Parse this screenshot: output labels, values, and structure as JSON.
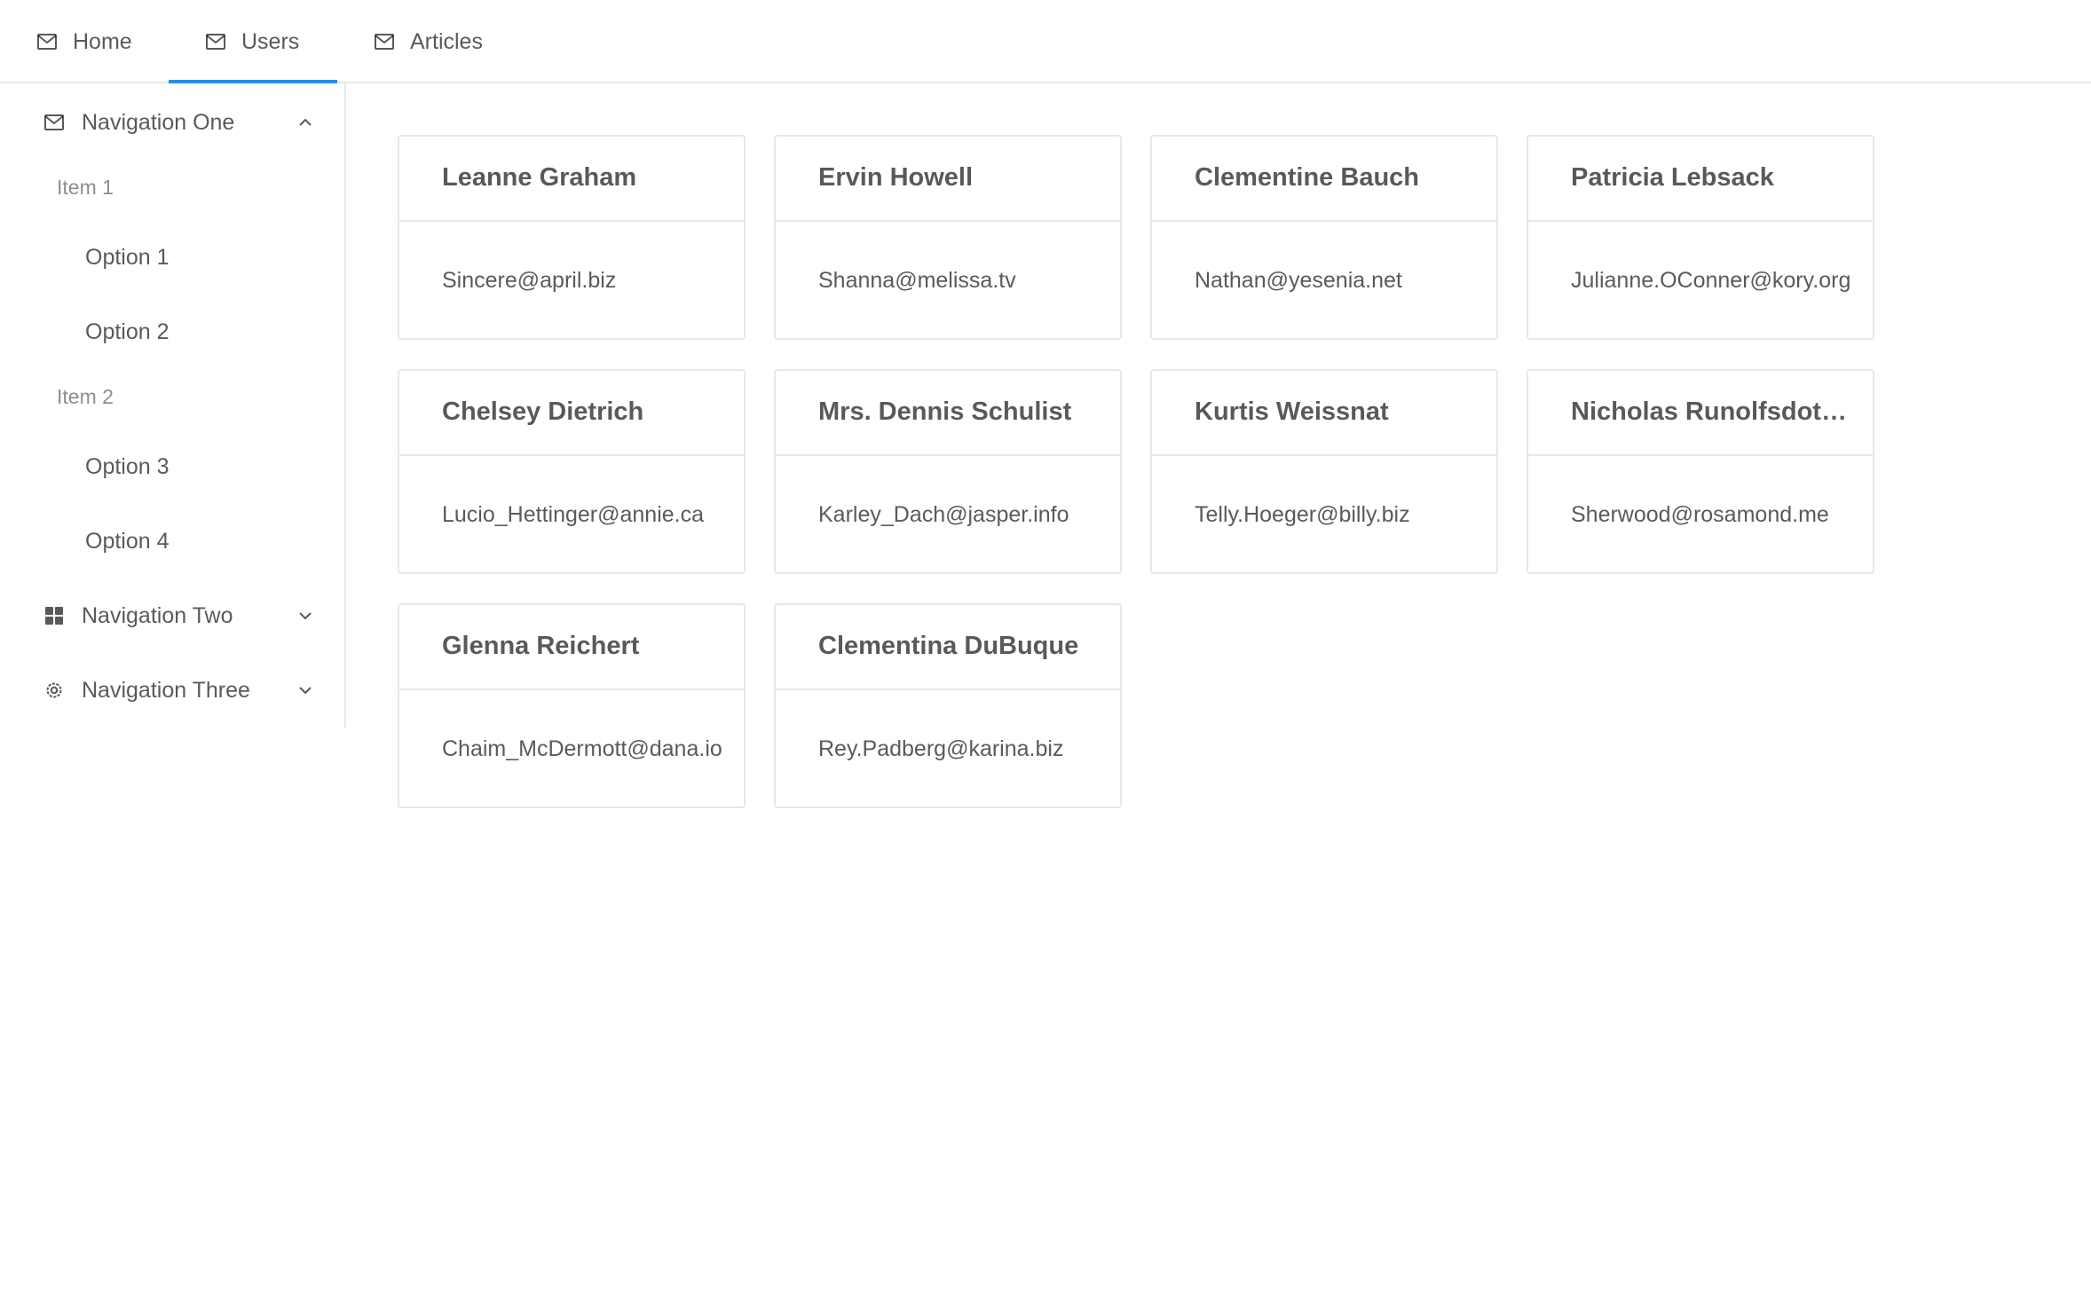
{
  "topnav": {
    "tabs": [
      {
        "label": "Home",
        "icon": "mail-icon"
      },
      {
        "label": "Users",
        "icon": "mail-icon",
        "active": true
      },
      {
        "label": "Articles",
        "icon": "mail-icon"
      }
    ]
  },
  "colors": {
    "accent": "#1890ff",
    "border": "#e8e8e8",
    "text": "#595959",
    "muted": "#8c8c8c"
  },
  "sidebar": {
    "nav_one": {
      "label": "Navigation One",
      "icon": "mail-icon",
      "expanded": true
    },
    "item1": {
      "label": "Item 1"
    },
    "option1": {
      "label": "Option 1"
    },
    "option2": {
      "label": "Option 2"
    },
    "item2": {
      "label": "Item 2"
    },
    "option3": {
      "label": "Option 3"
    },
    "option4": {
      "label": "Option 4"
    },
    "nav_two": {
      "label": "Navigation Two",
      "icon": "appstore-icon",
      "expanded": false
    },
    "nav_three": {
      "label": "Navigation Three",
      "icon": "setting-icon",
      "expanded": false
    }
  },
  "users": [
    {
      "name": "Leanne Graham",
      "email": "Sincere@april.biz"
    },
    {
      "name": "Ervin Howell",
      "email": "Shanna@melissa.tv"
    },
    {
      "name": "Clementine Bauch",
      "email": "Nathan@yesenia.net"
    },
    {
      "name": "Patricia Lebsack",
      "email": "Julianne.OConner@kory.org"
    },
    {
      "name": "Chelsey Dietrich",
      "email": "Lucio_Hettinger@annie.ca"
    },
    {
      "name": "Mrs. Dennis Schulist",
      "email": "Karley_Dach@jasper.info"
    },
    {
      "name": "Kurtis Weissnat",
      "email": "Telly.Hoeger@billy.biz"
    },
    {
      "name": "Nicholas Runolfsdottir V",
      "email": "Sherwood@rosamond.me"
    },
    {
      "name": "Glenna Reichert",
      "email": "Chaim_McDermott@dana.io"
    },
    {
      "name": "Clementina DuBuque",
      "email": "Rey.Padberg@karina.biz"
    }
  ]
}
